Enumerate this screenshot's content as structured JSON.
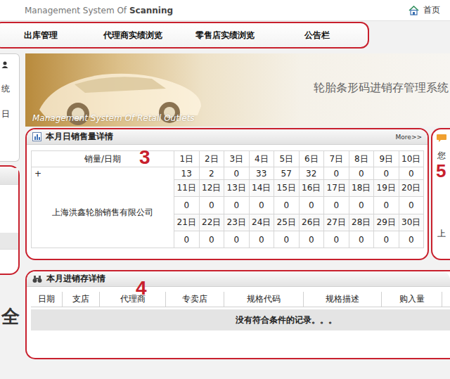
{
  "header": {
    "title": "Management System Of ",
    "title_bold": "Scanning",
    "home": "首页"
  },
  "nav": [
    {
      "label": "出库管理"
    },
    {
      "label": "代理商实绩浏览"
    },
    {
      "label": "零售店实绩浏览"
    },
    {
      "label": "公告栏"
    }
  ],
  "sidebar": {
    "lines": [
      "统",
      "日"
    ],
    "mark": "全"
  },
  "banner": {
    "title": "轮胎条形码进销存管理系统",
    "subtitle": "Management System Of Retail Outlets"
  },
  "sales": {
    "title": "本月日销售量详情",
    "more": "More>>",
    "annotation": "3",
    "corner": "销量/日期",
    "expand": "+",
    "company": "上海洪鑫轮胎销售有限公司",
    "weeks": [
      {
        "days": [
          "1日",
          "2日",
          "3日",
          "4日",
          "5日",
          "6日",
          "7日",
          "8日",
          "9日",
          "10日"
        ],
        "values": [
          "13",
          "2",
          "0",
          "33",
          "57",
          "32",
          "0",
          "0",
          "0",
          "0"
        ]
      },
      {
        "days": [
          "11日",
          "12日",
          "13日",
          "14日",
          "15日",
          "16日",
          "17日",
          "18日",
          "19日",
          "20日"
        ],
        "values": [
          "0",
          "0",
          "0",
          "0",
          "0",
          "0",
          "0",
          "0",
          "0",
          "0"
        ]
      },
      {
        "days": [
          "21日",
          "22日",
          "23日",
          "24日",
          "25日",
          "26日",
          "27日",
          "28日",
          "29日",
          "30日"
        ],
        "values": [
          "0",
          "0",
          "0",
          "0",
          "0",
          "0",
          "0",
          "0",
          "0",
          "0"
        ]
      }
    ]
  },
  "notice": {
    "annotation": "5",
    "lines": [
      "您",
      "上"
    ]
  },
  "inventory": {
    "title": "本月进销存详情",
    "annotation": "4",
    "columns": [
      "日期",
      "支店",
      "代理商",
      "专卖店",
      "规格代码",
      "规格描述",
      "购入量"
    ],
    "empty": "没有符合条件的记录。。。"
  }
}
